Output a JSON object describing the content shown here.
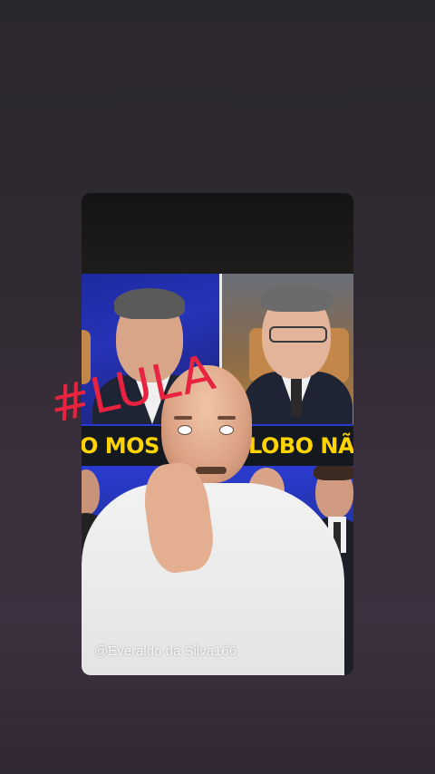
{
  "story": {
    "headline_left": "O MOS",
    "headline_right": "LOBO NÃO",
    "hashtag": "#LULA",
    "watermark": "@Everaldo da Silva166"
  },
  "colors": {
    "headline_text": "#ffd400",
    "hashtag": "#e8233f",
    "left_photo_bg": "#2633b8",
    "background": "#2f2a31"
  }
}
